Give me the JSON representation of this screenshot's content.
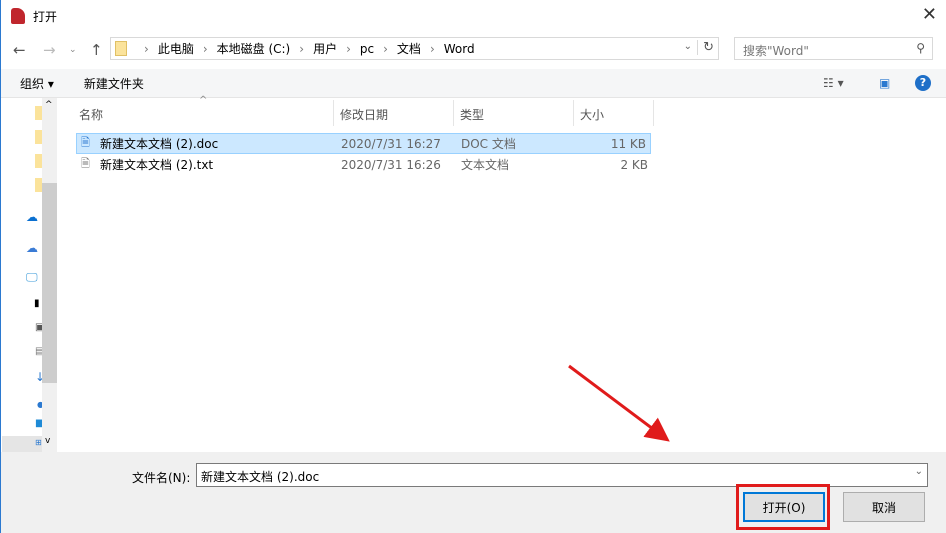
{
  "window": {
    "title": "打开"
  },
  "address": {
    "crumbs": [
      "此电脑",
      "本地磁盘 (C:)",
      "用户",
      "pc",
      "文档",
      "Word"
    ],
    "search_placeholder": "搜索\"Word\""
  },
  "toolbar": {
    "organize": "组织",
    "new_folder": "新建文件夹"
  },
  "columns": [
    "名称",
    "修改日期",
    "类型",
    "大小"
  ],
  "files": [
    {
      "name": "新建文本文档 (2).doc",
      "date": "2020/7/31 16:27",
      "type": "DOC 文档",
      "size": "11 KB",
      "selected": true
    },
    {
      "name": "新建文本文档 (2).txt",
      "date": "2020/7/31 16:26",
      "type": "文本文档",
      "size": "2 KB",
      "selected": false
    }
  ],
  "footer": {
    "filename_label": "文件名(N):",
    "filename_value": "新建文本文档 (2).doc",
    "open": "打开(O)",
    "cancel": "取消"
  },
  "colors": {
    "accent": "#0078d7",
    "annotation": "#e01b1b"
  }
}
